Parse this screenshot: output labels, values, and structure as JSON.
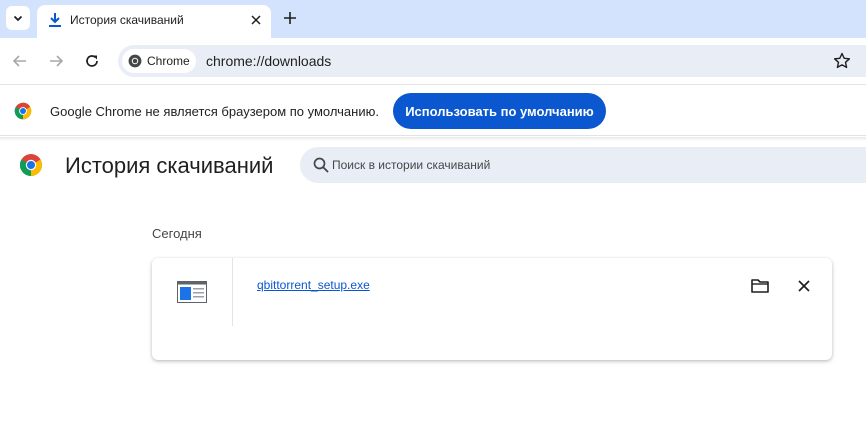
{
  "tab": {
    "title": "История скачиваний"
  },
  "toolbar": {
    "chip_label": "Chrome",
    "url": "chrome://downloads"
  },
  "infobar": {
    "message": "Google Chrome не является браузером по умолчанию.",
    "button_label": "Использовать по умолчанию"
  },
  "downloads": {
    "page_title": "История скачиваний",
    "search_placeholder": "Поиск в истории скачиваний",
    "date_heading": "Сегодня",
    "items": [
      {
        "file_name": "qbittorrent_setup.exe"
      }
    ]
  },
  "colors": {
    "accent": "#0b57d0",
    "tabstrip": "#d3e3fd",
    "omnibox": "#e9eef6"
  },
  "icons": [
    "chevron-down-icon",
    "download-icon",
    "close-icon",
    "plus-icon",
    "back-arrow-icon",
    "forward-arrow-icon",
    "reload-icon",
    "chrome-logo-icon",
    "star-icon",
    "search-icon",
    "exe-file-icon",
    "folder-icon"
  ]
}
